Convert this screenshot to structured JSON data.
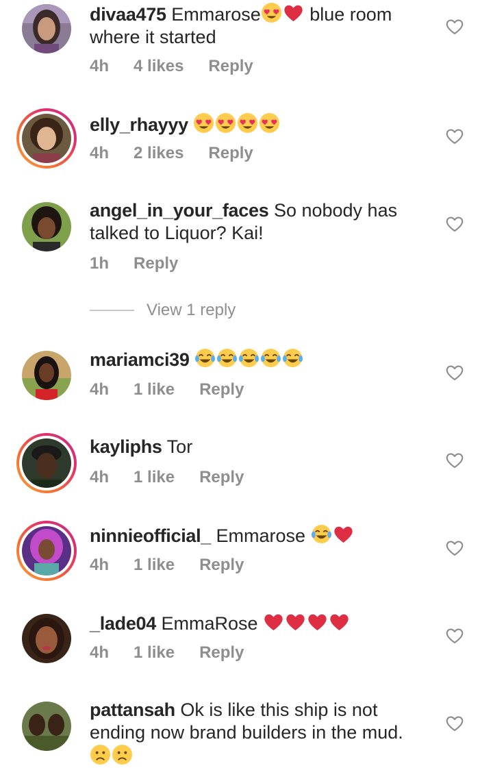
{
  "comments": [
    {
      "username": "divaa475",
      "text_a": "Emmarose",
      "emojis": [
        "heart-eyes-emoji",
        "red-heart-emoji"
      ],
      "text_b": " blue room where it started",
      "time": "4h",
      "likes": "4 likes",
      "reply": "Reply"
    },
    {
      "username": "elly_rhayyy",
      "emojis": [
        "heart-eyes-emoji",
        "heart-eyes-emoji",
        "heart-eyes-emoji",
        "heart-eyes-emoji"
      ],
      "time": "4h",
      "likes": "2 likes",
      "reply": "Reply"
    },
    {
      "username": "angel_in_your_faces",
      "text_a": "So nobody has talked to Liquor? Kai!",
      "time": "1h",
      "reply": "Reply"
    },
    {
      "username": "mariamci39",
      "emojis": [
        "tears-of-joy-emoji",
        "tears-of-joy-emoji",
        "tears-of-joy-emoji",
        "tears-of-joy-emoji",
        "tears-of-joy-emoji"
      ],
      "time": "4h",
      "likes": "1 like",
      "reply": "Reply"
    },
    {
      "username": "kayliphs",
      "text_a": "Tor",
      "time": "4h",
      "likes": "1 like",
      "reply": "Reply"
    },
    {
      "username": "ninnieofficial_",
      "text_a": "Emmarose ",
      "emojis": [
        "tears-of-joy-emoji",
        "red-heart-emoji"
      ],
      "time": "4h",
      "likes": "1 like",
      "reply": "Reply"
    },
    {
      "username": "_lade04",
      "text_a": "EmmaRose ",
      "emojis": [
        "red-heart-emoji",
        "red-heart-emoji",
        "red-heart-emoji",
        "red-heart-emoji"
      ],
      "time": "4h",
      "likes": "1 like",
      "reply": "Reply"
    },
    {
      "username": "pattansah",
      "text_a": "Ok is like this ship is not ending now brand builders in the mud.",
      "emojis": [
        "crying-emoji",
        "crying-emoji"
      ]
    }
  ],
  "view_replies": {
    "label": "View 1 reply"
  },
  "icons": {
    "like": "heart-outline-icon"
  },
  "colors": {
    "meta_text": "#8e8e8e",
    "username_text": "#262626",
    "story_ring_start": "#f9a13c",
    "story_ring_end": "#c13584"
  }
}
